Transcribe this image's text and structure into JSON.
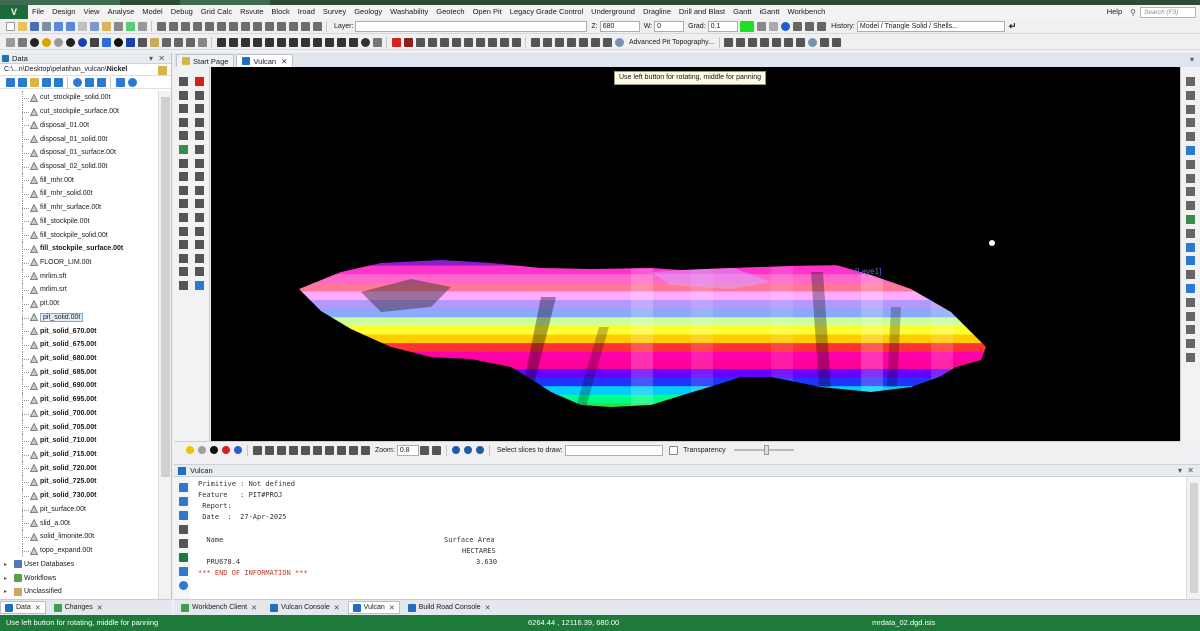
{
  "menubar": {
    "items": [
      "File",
      "Design",
      "View",
      "Analyse",
      "Model",
      "Debug",
      "Grid Calc",
      "Rsvute",
      "Block",
      "Iroad",
      "Survey",
      "Geology",
      "Washability",
      "Geotech",
      "Open Pit",
      "Legacy Grade Control",
      "Underground",
      "Dragline",
      "Drill and Blast",
      "Gantt",
      "iGantt",
      "Workbench"
    ],
    "help": "Help",
    "search_placeholder": "Search (F3)"
  },
  "toolbar1": {
    "layer_label": "Layer:",
    "layer_value": "",
    "z_label": "Z:",
    "z_value": "680",
    "w_label": "W:",
    "w_value": "0",
    "grad_label": "Grad:",
    "grad_value": "0.1",
    "history_label": "History:",
    "history_value": "Model / Triangle Solid / Shells..."
  },
  "toolbar2": {
    "advanced_label": "Advanced Pit Topography..."
  },
  "data_pane": {
    "title": "Data",
    "path_prefix": "C:\\...n\\Desktop\\pelatihan_vulcan\\",
    "path_leaf": "Nickel",
    "files": [
      {
        "name": "cut_stockpile_solid.00t",
        "bold": false
      },
      {
        "name": "cut_stockpile_surface.00t",
        "bold": false
      },
      {
        "name": "disposal_01.00t",
        "bold": false
      },
      {
        "name": "disposal_01_solid.00t",
        "bold": false
      },
      {
        "name": "disposal_01_surface.00t",
        "bold": false
      },
      {
        "name": "disposal_02_solid.00t",
        "bold": false
      },
      {
        "name": "fill_mhr.00t",
        "bold": false
      },
      {
        "name": "fill_mhr_solid.00t",
        "bold": false
      },
      {
        "name": "fill_mhr_surface.00t",
        "bold": false
      },
      {
        "name": "fill_stockpile.00t",
        "bold": false
      },
      {
        "name": "fill_stockpile_solid.00t",
        "bold": false
      },
      {
        "name": "fill_stockpile_surface.00t",
        "bold": true
      },
      {
        "name": "FLOOR_LIM.00t",
        "bold": false
      },
      {
        "name": "mrlim.sft",
        "bold": false
      },
      {
        "name": "mrlim.srt",
        "bold": false
      },
      {
        "name": "pit.00t",
        "bold": false
      },
      {
        "name": "pit_solid.00t",
        "bold": false,
        "selected": true
      },
      {
        "name": "pit_solid_670.00t",
        "bold": true
      },
      {
        "name": "pit_solid_675.00t",
        "bold": true
      },
      {
        "name": "pit_solid_680.00t",
        "bold": true
      },
      {
        "name": "pit_solid_685.00t",
        "bold": true
      },
      {
        "name": "pit_solid_690.00t",
        "bold": true
      },
      {
        "name": "pit_solid_695.00t",
        "bold": true
      },
      {
        "name": "pit_solid_700.00t",
        "bold": true
      },
      {
        "name": "pit_solid_705.00t",
        "bold": true
      },
      {
        "name": "pit_solid_710.00t",
        "bold": true
      },
      {
        "name": "pit_solid_715.00t",
        "bold": true
      },
      {
        "name": "pit_solid_720.00t",
        "bold": true
      },
      {
        "name": "pit_solid_725.00t",
        "bold": true
      },
      {
        "name": "pit_solid_730.00t",
        "bold": true
      },
      {
        "name": "pit_surface.00t",
        "bold": false
      },
      {
        "name": "slid_a.00t",
        "bold": false
      },
      {
        "name": "solid_limonite.00t",
        "bold": false
      },
      {
        "name": "topo_expand.00t",
        "bold": false
      }
    ],
    "groups": [
      "User Databases",
      "Workflows",
      "Unclassified"
    ],
    "tabs": [
      "Data",
      "Changes"
    ]
  },
  "doc_tabs": [
    "Start Page",
    "Vulcan"
  ],
  "viewport": {
    "tooltip": "Use left button for rotating, middle for panning",
    "layer_label": "[Laye1]",
    "shade_colors": [
      "#8a1ccc",
      "#ff33cc",
      "#ff66cc",
      "#ff7799",
      "#ffaaff",
      "#b399ff",
      "#88aaff",
      "#ccff99",
      "#ffff33",
      "#ffcc00",
      "#ff3333",
      "#ff00aa",
      "#ff0099",
      "#6600ff",
      "#2233ff",
      "#00ccff",
      "#00ff88",
      "#33dd33"
    ]
  },
  "vp_bottom": {
    "zoom_label": "Zoom:",
    "zoom_value": "0.8",
    "slices_label": "Select slices to draw:",
    "slices_value": "",
    "transparency_label": "Transparency"
  },
  "console": {
    "title": "Vulcan",
    "lines": [
      "Primitive : Not defined",
      "Feature   : PIT#PROJ",
      " Report:",
      " Date  :  27-Apr-2025",
      "",
      "  Name",
      "  PRU678.4",
      "*** END OF INFORMATION ***"
    ],
    "col_header_1": "Surface Area",
    "col_header_2": "HECTARES",
    "col_value": "3.630"
  },
  "main_tabs": [
    "Workbench Client",
    "Vulcan Console",
    "Vulcan",
    "Build Road Console"
  ],
  "statusbar": {
    "message": "Use left button for rotating, middle for panning",
    "coords": "6264.44 , 12116.39, 680.00",
    "file": "mrdata_02.dgd.isis"
  }
}
